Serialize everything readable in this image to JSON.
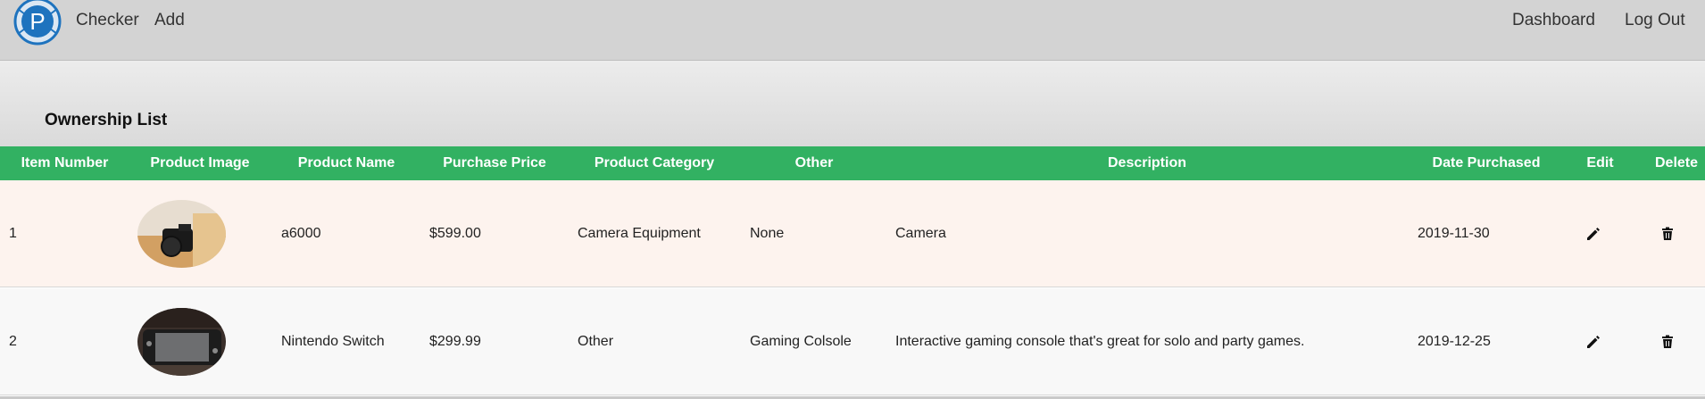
{
  "navbar": {
    "logo_letter": "P",
    "links": [
      "Checker",
      "Add"
    ],
    "right_links": [
      "Dashboard",
      "Log Out"
    ]
  },
  "page": {
    "title": "Ownership List"
  },
  "table": {
    "columns": [
      "Item Number",
      "Product Image",
      "Product Name",
      "Purchase Price",
      "Product Category",
      "Other",
      "Description",
      "Date Purchased",
      "Edit",
      "Delete"
    ],
    "rows": [
      {
        "item_number": "1",
        "image": "camera-photo",
        "product_name": "a6000",
        "purchase_price": "$599.00",
        "category": "Camera Equipment",
        "other": "None",
        "description": "Camera",
        "date_purchased": "2019-11-30"
      },
      {
        "item_number": "2",
        "image": "nintendo-switch-photo",
        "product_name": "Nintendo Switch",
        "purchase_price": "$299.99",
        "category": "Other",
        "other": "Gaming Colsole",
        "description": "Interactive gaming console that's great for solo and party games.",
        "date_purchased": "2019-12-25"
      }
    ],
    "icons": {
      "edit": "pencil-icon",
      "delete": "trash-icon"
    }
  },
  "colors": {
    "navbar_bg": "#d3d3d3",
    "header_green": "#32b162",
    "row1_bg": "#fdf3ee",
    "row2_bg": "#f8f8f8",
    "logo_blue": "#1e73be"
  }
}
